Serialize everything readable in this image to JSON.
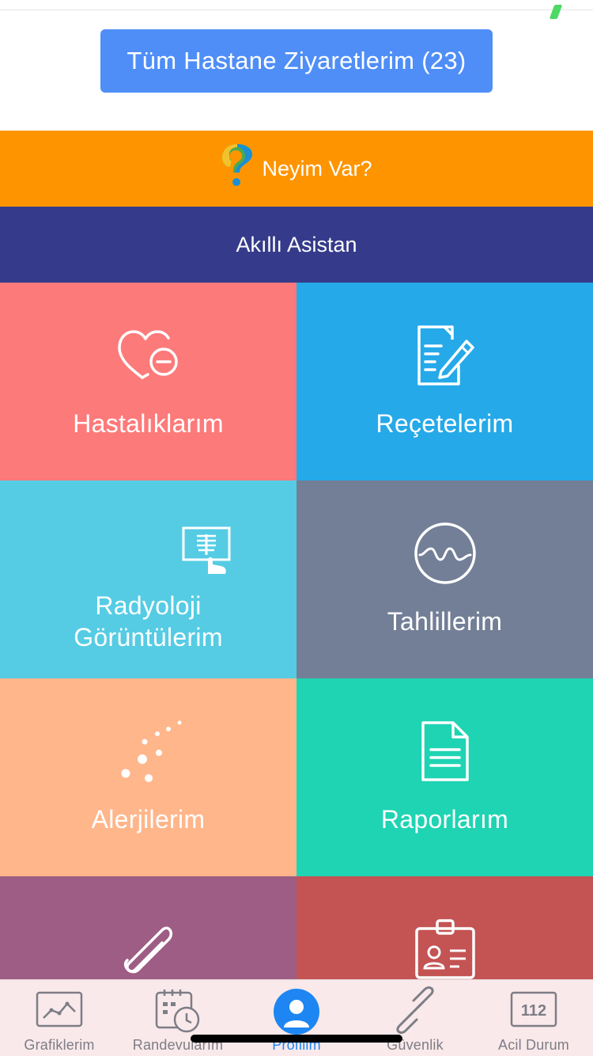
{
  "header": {
    "visits_button_label": "Tüm Hastane Ziyaretlerim (23)"
  },
  "bands": {
    "neyim_var_label": "Neyim Var?",
    "neyim_var_color": "#fe9500",
    "asistan_label": "Akıllı Asistan",
    "asistan_color": "#353b8a"
  },
  "tiles": [
    {
      "label": "Hastalıklarım",
      "icon": "heart-minus-icon",
      "color": "#fd7a7a"
    },
    {
      "label": "Reçetelerim",
      "icon": "prescription-edit-icon",
      "color": "#25a9e9"
    },
    {
      "label_line1": "Radyoloji",
      "label_line2": "Görüntülerim",
      "icon": "xray-icon",
      "color": "#55cce4"
    },
    {
      "label": "Tahlillerim",
      "icon": "wave-circle-icon",
      "color": "#737f97"
    },
    {
      "label": "Alerjilerim",
      "icon": "particles-icon",
      "color": "#ffb68b"
    },
    {
      "label": "Raporlarım",
      "icon": "document-icon",
      "color": "#1ed4b3"
    },
    {
      "icon": "paperclip-icon",
      "color": "#9e5d84"
    },
    {
      "icon": "id-badge-icon",
      "color": "#c45353"
    }
  ],
  "tabbar": {
    "tabs": [
      {
        "label": "Grafiklerim",
        "icon": "chart-icon",
        "active": false
      },
      {
        "label": "Randevularım",
        "icon": "calendar-clock-icon",
        "active": false
      },
      {
        "label": "Profilim",
        "icon": "profile-icon",
        "active": true
      },
      {
        "label": "Güvenlik",
        "icon": "link-icon",
        "active": false
      },
      {
        "label": "Acil Durum",
        "icon": "emergency-112-icon",
        "active": false,
        "badge_text": "112"
      }
    ],
    "active_color": "#1e86f2"
  }
}
